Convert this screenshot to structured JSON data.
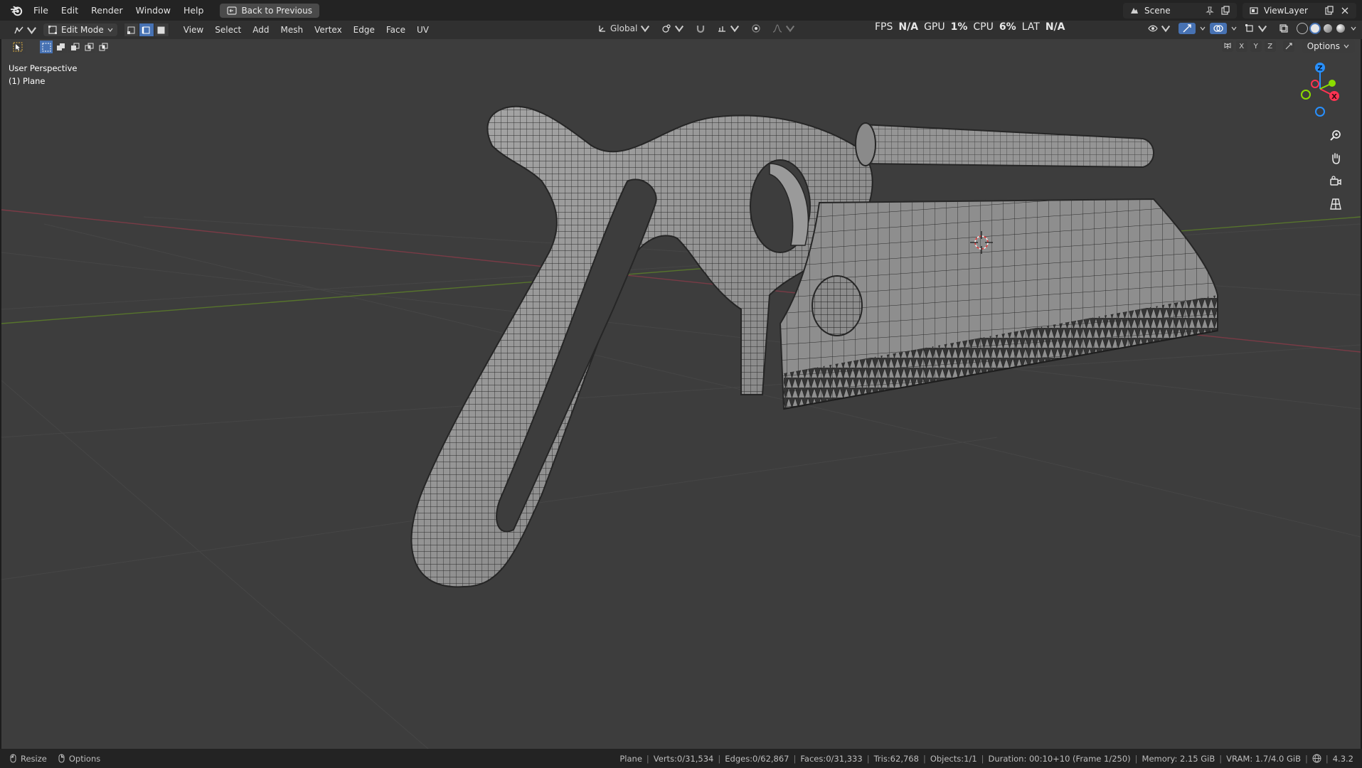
{
  "topbar": {
    "menus": [
      "File",
      "Edit",
      "Render",
      "Window",
      "Help"
    ],
    "back_button": "Back to Previous",
    "scene": "Scene",
    "view_layer": "ViewLayer"
  },
  "header": {
    "mode": "Edit Mode",
    "menus": [
      "View",
      "Select",
      "Add",
      "Mesh",
      "Vertex",
      "Edge",
      "Face",
      "UV"
    ],
    "orientation": "Global",
    "perf": {
      "fps_label": "FPS",
      "fps": "N/A",
      "gpu_label": "GPU",
      "gpu": "1%",
      "cpu_label": "CPU",
      "cpu": "6%",
      "lat_label": "LAT",
      "lat": "N/A"
    }
  },
  "toolrow": {
    "axes": [
      "X",
      "Y",
      "Z"
    ],
    "options": "Options"
  },
  "viewport": {
    "perspective": "User Perspective",
    "object": "(1) Plane",
    "gizmo_z": "Z",
    "gizmo_x": "X"
  },
  "status": {
    "resize": "Resize",
    "options": "Options",
    "object": "Plane",
    "verts": "Verts:0/31,534",
    "edges": "Edges:0/62,867",
    "faces": "Faces:0/31,333",
    "tris": "Tris:62,768",
    "objects": "Objects:1/1",
    "duration": "Duration: 00:10+10 (Frame 1/250)",
    "memory": "Memory: 2.15 GiB",
    "vram": "VRAM: 1.7/4.0 GiB",
    "version": "4.3.2"
  },
  "colors": {
    "accent": "#4772b3",
    "axis_x": "#ff3352",
    "axis_y": "#8bdc00",
    "axis_z": "#2890ff"
  }
}
